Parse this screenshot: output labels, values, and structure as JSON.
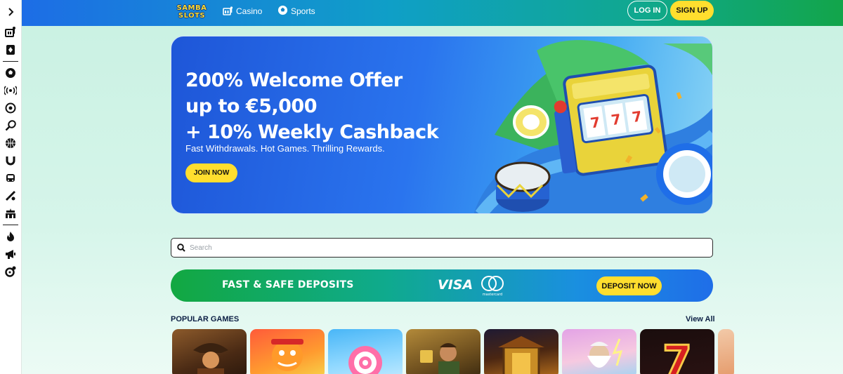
{
  "sidebar": {
    "items": [
      {
        "icon": "casino-icon"
      },
      {
        "icon": "card-icon"
      },
      {
        "icon": "soccer-icon"
      },
      {
        "icon": "live-icon"
      },
      {
        "icon": "circle-play-icon"
      },
      {
        "icon": "tennis-icon"
      },
      {
        "icon": "basketball-icon"
      },
      {
        "icon": "horseshoe-icon"
      },
      {
        "icon": "vehicle-icon"
      },
      {
        "icon": "cricket-icon"
      },
      {
        "icon": "stadium-icon"
      },
      {
        "icon": "flame-icon"
      },
      {
        "icon": "megaphone-icon"
      },
      {
        "icon": "support-icon"
      }
    ]
  },
  "header": {
    "logo_line1": "SAMBA",
    "logo_line2": "SLOTS",
    "nav": [
      {
        "label": "Casino",
        "icon": "slot-machine-icon"
      },
      {
        "label": "Sports",
        "icon": "soccer-ball-icon"
      }
    ],
    "login_label": "LOG IN",
    "signup_label": "SIGN UP"
  },
  "hero": {
    "title_line1": "200% Welcome Offer",
    "title_line2": "up to €5,000",
    "title_line3": "+ 10% Weekly Cashback",
    "subtitle": "Fast Withdrawals. Hot Games. Thrilling Rewards.",
    "cta_label": "JOIN NOW"
  },
  "search": {
    "placeholder": "Search",
    "value": ""
  },
  "deposit": {
    "text": "FAST & SAFE DEPOSITS",
    "visa_label": "VISA",
    "mastercard_label": "mastercard",
    "cta_label": "DEPOSIT NOW"
  },
  "popular": {
    "title": "POPULAR GAMES",
    "view_all": "View All",
    "games": [
      {
        "name": "game-cowboy"
      },
      {
        "name": "game-fortune-tiger"
      },
      {
        "name": "game-candy"
      },
      {
        "name": "game-adventurer"
      },
      {
        "name": "game-treasure"
      },
      {
        "name": "game-zeus"
      },
      {
        "name": "game-seven"
      },
      {
        "name": "game-partial"
      }
    ]
  },
  "colors": {
    "accent_yellow": "#ffde2e",
    "header_blue": "#1d6de6",
    "header_green": "#12a54a",
    "navy_text": "#0c1f44"
  }
}
